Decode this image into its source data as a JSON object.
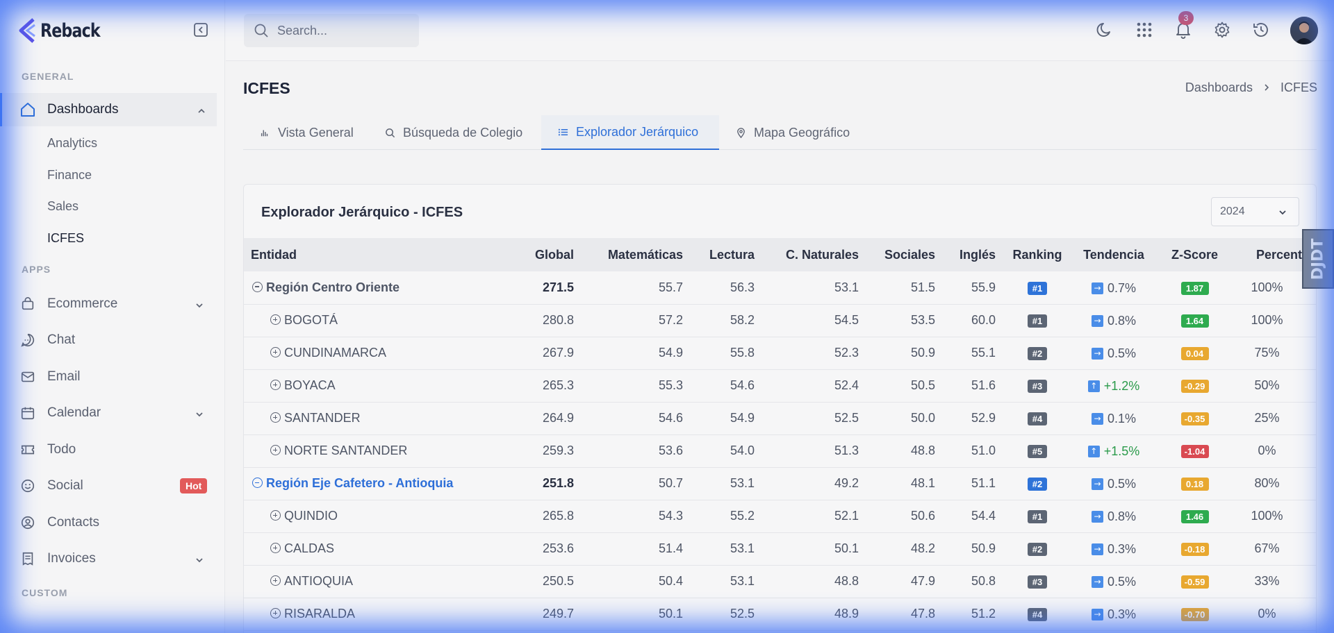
{
  "brand": {
    "name": "Reback"
  },
  "sidebar": {
    "section_general": "GENERAL",
    "section_apps": "APPS",
    "section_custom": "CUSTOM",
    "dashboards": {
      "label": "Dashboards",
      "icon": "home-icon"
    },
    "sub_items": [
      "Analytics",
      "Finance",
      "Sales",
      "ICFES"
    ],
    "apps": [
      {
        "label": "Ecommerce",
        "icon": "shopping-bag-icon"
      },
      {
        "label": "Chat",
        "icon": "chat-bubble-icon"
      },
      {
        "label": "Email",
        "icon": "mail-icon"
      },
      {
        "label": "Calendar",
        "icon": "calendar-icon"
      },
      {
        "label": "Todo",
        "icon": "ticket-icon"
      },
      {
        "label": "Social",
        "icon": "smiley-icon",
        "badge": "Hot"
      },
      {
        "label": "Contacts",
        "icon": "user-circle-icon"
      },
      {
        "label": "Invoices",
        "icon": "receipt-icon"
      }
    ]
  },
  "topbar": {
    "search_placeholder": "Search...",
    "notification_count": "3"
  },
  "page": {
    "title": "ICFES",
    "breadcrumb": [
      "Dashboards",
      "ICFES"
    ]
  },
  "tabs": [
    "Vista General",
    "Búsqueda de Colegio",
    "Explorador Jerárquico",
    "Mapa Geográfico"
  ],
  "card": {
    "title": "Explorador Jerárquico - ICFES",
    "year": "2024"
  },
  "table": {
    "headers": [
      "Entidad",
      "Global",
      "Matemáticas",
      "Lectura",
      "C. Naturales",
      "Sociales",
      "Inglés",
      "Ranking",
      "Tendencia",
      "Z-Score",
      "Percentil"
    ],
    "rows": [
      {
        "name": "Región Centro Oriente",
        "region": true,
        "expanded": true,
        "global": "271.5",
        "mat": "55.7",
        "lec": "56.3",
        "nat": "53.1",
        "soc": "51.5",
        "ing": "55.9",
        "rank": "#1",
        "trend": "0.7%",
        "trend_dir": "right",
        "z": "1.87",
        "z_color": "green",
        "pct": "100%"
      },
      {
        "name": "BOGOTÁ",
        "global": "280.8",
        "mat": "57.2",
        "lec": "58.2",
        "nat": "54.5",
        "soc": "53.5",
        "ing": "60.0",
        "rank": "#1",
        "trend": "0.8%",
        "trend_dir": "right",
        "z": "1.64",
        "z_color": "green",
        "pct": "100%"
      },
      {
        "name": "CUNDINAMARCA",
        "global": "267.9",
        "mat": "54.9",
        "lec": "55.8",
        "nat": "52.3",
        "soc": "50.9",
        "ing": "55.1",
        "rank": "#2",
        "trend": "0.5%",
        "trend_dir": "right",
        "z": "0.04",
        "z_color": "yellow",
        "pct": "75%"
      },
      {
        "name": "BOYACA",
        "global": "265.3",
        "mat": "55.3",
        "lec": "54.6",
        "nat": "52.4",
        "soc": "50.5",
        "ing": "51.6",
        "rank": "#3",
        "trend": "+1.2%",
        "trend_dir": "up",
        "z": "-0.29",
        "z_color": "yellow",
        "pct": "50%"
      },
      {
        "name": "SANTANDER",
        "global": "264.9",
        "mat": "54.6",
        "lec": "54.9",
        "nat": "52.5",
        "soc": "50.0",
        "ing": "52.9",
        "rank": "#4",
        "trend": "0.1%",
        "trend_dir": "right",
        "z": "-0.35",
        "z_color": "yellow",
        "pct": "25%"
      },
      {
        "name": "NORTE SANTANDER",
        "global": "259.3",
        "mat": "53.6",
        "lec": "54.0",
        "nat": "51.3",
        "soc": "48.8",
        "ing": "51.0",
        "rank": "#5",
        "trend": "+1.5%",
        "trend_dir": "up",
        "z": "-1.04",
        "z_color": "red",
        "pct": "0%"
      },
      {
        "name": "Región Eje Cafetero - Antioquia",
        "region": true,
        "expanded": true,
        "highlight": true,
        "global": "251.8",
        "mat": "50.7",
        "lec": "53.1",
        "nat": "49.2",
        "soc": "48.1",
        "ing": "51.1",
        "rank": "#2",
        "trend": "0.5%",
        "trend_dir": "right",
        "z": "0.18",
        "z_color": "yellow",
        "pct": "80%"
      },
      {
        "name": "QUINDIO",
        "global": "265.8",
        "mat": "54.3",
        "lec": "55.2",
        "nat": "52.1",
        "soc": "50.6",
        "ing": "54.4",
        "rank": "#1",
        "trend": "0.8%",
        "trend_dir": "right",
        "z": "1.46",
        "z_color": "green",
        "pct": "100%"
      },
      {
        "name": "CALDAS",
        "global": "253.6",
        "mat": "51.4",
        "lec": "53.1",
        "nat": "50.1",
        "soc": "48.2",
        "ing": "50.9",
        "rank": "#2",
        "trend": "0.3%",
        "trend_dir": "right",
        "z": "-0.18",
        "z_color": "yellow",
        "pct": "67%"
      },
      {
        "name": "ANTIOQUIA",
        "global": "250.5",
        "mat": "50.4",
        "lec": "53.1",
        "nat": "48.8",
        "soc": "47.9",
        "ing": "50.8",
        "rank": "#3",
        "trend": "0.5%",
        "trend_dir": "right",
        "z": "-0.59",
        "z_color": "yellow",
        "pct": "33%"
      },
      {
        "name": "RISARALDA",
        "global": "249.7",
        "mat": "50.1",
        "lec": "52.5",
        "nat": "48.9",
        "soc": "47.8",
        "ing": "51.2",
        "rank": "#4",
        "trend": "0.3%",
        "trend_dir": "right",
        "z": "-0.70",
        "z_color": "yellow",
        "pct": "0%"
      }
    ]
  },
  "edge_widget": {
    "label": "DJDT"
  },
  "colors": {
    "accent": "#2e6fd8",
    "vignette": "#3c6ef5",
    "hot": "#e25a5a"
  }
}
